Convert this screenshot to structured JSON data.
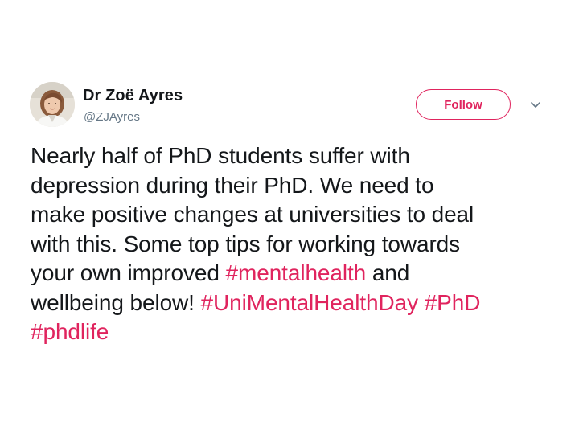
{
  "user": {
    "display_name": "Dr Zoë Ayres",
    "handle": "@ZJAyres"
  },
  "actions": {
    "follow_label": "Follow",
    "more_icon": "chevron-down-icon"
  },
  "tweet": {
    "lines": [
      [
        {
          "text": "Nearly half of PhD students suffer with",
          "hashtag": false
        }
      ],
      [
        {
          "text": "depression during their PhD. We need to",
          "hashtag": false
        }
      ],
      [
        {
          "text": "make positive changes at universities to deal",
          "hashtag": false
        }
      ],
      [
        {
          "text": "with this.  Some top tips for working towards",
          "hashtag": false
        }
      ],
      [
        {
          "text": "your own improved ",
          "hashtag": false
        },
        {
          "text": "#mentalhealth",
          "hashtag": true
        },
        {
          "text": " and",
          "hashtag": false
        }
      ],
      [
        {
          "text": "wellbeing below! ",
          "hashtag": false
        },
        {
          "text": "#UniMentalHealthDay",
          "hashtag": true
        },
        {
          "text": " ",
          "hashtag": false
        },
        {
          "text": "#PhD",
          "hashtag": true
        }
      ],
      [
        {
          "text": "#phdlife",
          "hashtag": true
        }
      ]
    ]
  },
  "colors": {
    "accent": "#e0245e",
    "text": "#14171a",
    "secondary": "#657786"
  }
}
